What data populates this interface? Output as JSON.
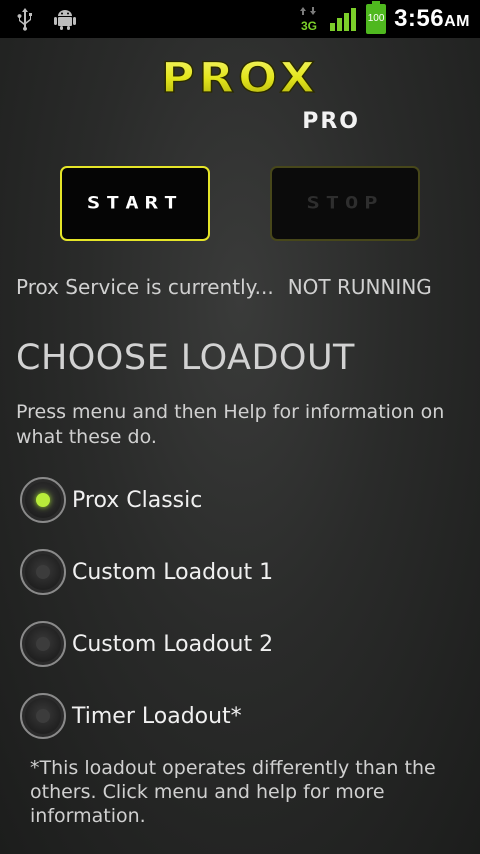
{
  "status_bar": {
    "time": "3:56",
    "ampm": "AM",
    "battery_level": "100",
    "network": "3G",
    "icons": [
      "usb-icon",
      "android-debug-icon",
      "data-3g-icon",
      "signal-icon",
      "battery-icon"
    ]
  },
  "logo": {
    "main": "PROX",
    "sub": "PRO"
  },
  "buttons": {
    "start": "START",
    "stop": "STOP"
  },
  "service": {
    "label": "Prox Service is currently...",
    "state": "NOT RUNNING"
  },
  "loadout": {
    "heading": "CHOOSE LOADOUT",
    "help": "Press menu and then Help for information on what these do.",
    "options": [
      {
        "label": "Prox Classic",
        "checked": true
      },
      {
        "label": "Custom Loadout 1",
        "checked": false
      },
      {
        "label": "Custom Loadout 2",
        "checked": false
      },
      {
        "label": "Timer Loadout*",
        "checked": false
      }
    ],
    "note": "*This loadout operates differently than the others. Click menu and help for more information."
  },
  "colors": {
    "accent": "#e5e528",
    "radio_on": "#b8ec3a",
    "signal": "#7ccf2a"
  }
}
